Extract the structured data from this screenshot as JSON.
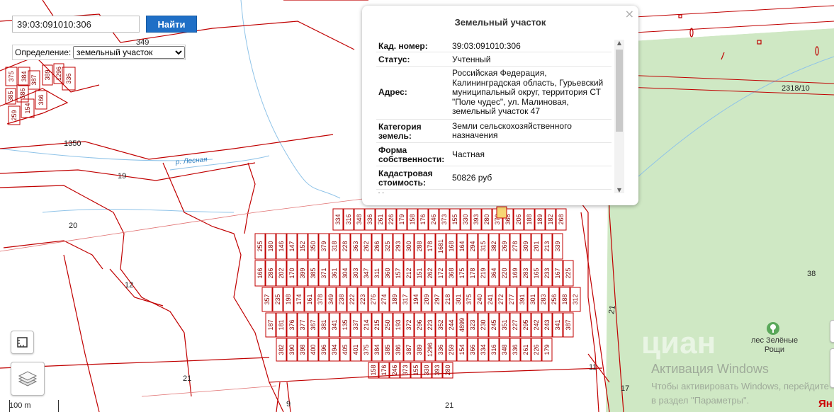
{
  "search": {
    "value": "39:03:091010:306",
    "button_label": "Найти"
  },
  "definition": {
    "label": "Определение:",
    "selected": "земельный участок"
  },
  "popup": {
    "title": "Земельный участок",
    "close_symbol": "×",
    "rows": [
      {
        "key": "Кад. номер:",
        "value": "39:03:091010:306"
      },
      {
        "key": "Статус:",
        "value": "Учтенный"
      },
      {
        "key": "Адрес:",
        "value": "Российская Федерация, Калининградская область, Гурьевский муниципальный округ, территория СТ \"Поле чудес\", ул. Малиновая, земельный участок 47"
      },
      {
        "key": "Категория земель:",
        "value": "Земли сельскохозяйственного назначения"
      },
      {
        "key": "Форма собственности:",
        "value": "Частная"
      },
      {
        "key": "Кадастровая стоимость:",
        "value": "50826 руб"
      },
      {
        "key": "Уточненная",
        "value": ""
      }
    ]
  },
  "map": {
    "big_labels": [
      "1350",
      "19",
      "20",
      "12",
      "21",
      "21",
      "9",
      "38",
      "21",
      "17",
      "11",
      "2318/10",
      "349"
    ],
    "river_label": "р. Лесная",
    "forest_label": "лес Зелёные Рощи",
    "parcel_numbers": [
      "375",
      "384",
      "385",
      "386",
      "387",
      "389",
      "1296",
      "336",
      "259",
      "154",
      "366",
      "334",
      "316",
      "348",
      "336",
      "261",
      "226",
      "179",
      "158",
      "176",
      "246",
      "373",
      "155",
      "330",
      "393",
      "280",
      "370",
      "368",
      "206",
      "188",
      "189",
      "182",
      "268",
      "255",
      "180",
      "146",
      "147",
      "152",
      "350",
      "379",
      "318",
      "228",
      "363",
      "262",
      "266",
      "325",
      "293",
      "300",
      "288",
      "178",
      "1681",
      "168",
      "164",
      "294",
      "315",
      "382",
      "269",
      "278",
      "309",
      "201",
      "213",
      "339",
      "166",
      "286",
      "202",
      "170",
      "399",
      "385",
      "371",
      "361",
      "304",
      "303",
      "347",
      "311",
      "360",
      "157",
      "212",
      "151",
      "262",
      "172",
      "368",
      "175",
      "178",
      "219",
      "364",
      "220",
      "169",
      "283",
      "165",
      "233",
      "167",
      "225",
      "357",
      "235",
      "198",
      "174",
      "161",
      "378",
      "349",
      "238",
      "222",
      "223",
      "276",
      "274",
      "189",
      "317",
      "194",
      "209",
      "297",
      "218",
      "301",
      "375",
      "240",
      "241",
      "272",
      "277",
      "391",
      "301",
      "283",
      "256",
      "188",
      "312",
      "187",
      "181",
      "376",
      "377",
      "367",
      "381",
      "341",
      "135",
      "337",
      "214",
      "215",
      "250",
      "193",
      "372",
      "296",
      "223",
      "352",
      "244",
      "4899",
      "323",
      "230",
      "245",
      "351",
      "227",
      "295",
      "242",
      "243",
      "341",
      "387",
      "382",
      "390",
      "398",
      "400",
      "396",
      "394",
      "405",
      "401"
    ],
    "colors": {
      "parcel": "#c00000",
      "forest": "#cfe8c4",
      "water": "#8fc3e8",
      "road": "#e07070"
    }
  },
  "controls": {
    "scale_label": "100 m",
    "ruler_icon": "ruler-icon",
    "layers_icon": "layers-icon"
  },
  "watermark": {
    "brand": "циан",
    "title": "Активация Windows",
    "subtitle": "Чтобы активировать Windows, перейдите в раздел \"Параметры\".",
    "yandex": "Ян"
  }
}
